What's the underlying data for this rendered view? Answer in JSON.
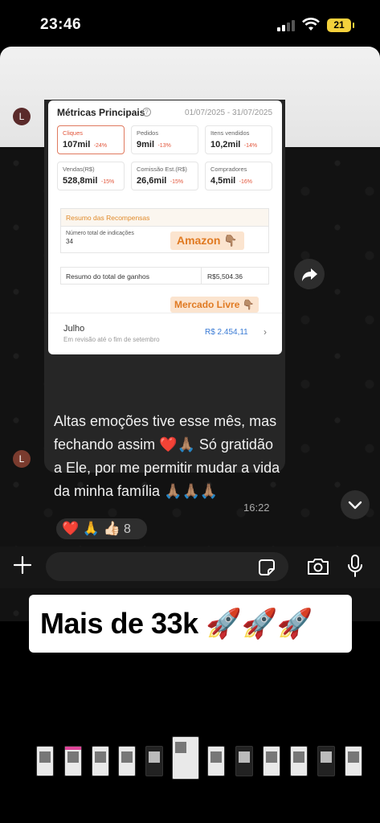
{
  "status_bar": {
    "time": "23:46",
    "battery": "21",
    "colors": {
      "battery": "#f4d13c"
    }
  },
  "chat": {
    "avatar_letter": "L",
    "screenshot": {
      "title": "Métricas Principais",
      "date_range": "01/07/2025 - 31/07/2025",
      "metrics": [
        {
          "label": "Cliques",
          "value": "107mil",
          "delta": "-24%"
        },
        {
          "label": "Pedidos",
          "value": "9mil",
          "delta": "-13%"
        },
        {
          "label": "Itens vendidos",
          "value": "10,2mil",
          "delta": "-14%"
        },
        {
          "label": "Vendas(R$)",
          "value": "528,8mil",
          "delta": "-15%"
        },
        {
          "label": "Comissão Est.(R$)",
          "value": "26,6mil",
          "delta": "-15%"
        },
        {
          "label": "Compradores",
          "value": "4,5mil",
          "delta": "-16%"
        }
      ],
      "rewards_header": "Resumo das Recompensas",
      "referrals_label": "Número total de indicações",
      "referrals_value": "34",
      "amazon_tag": "Amazon 👇🏽",
      "earnings_label": "Resumo do total de ganhos",
      "earnings_value": "R$5,504.36",
      "mercado_livre_tag": "Mercado Livre 👇🏽",
      "month": "Julho",
      "month_status": "Em revisão até o fim de setembro",
      "month_value": "R$ 2.454,11"
    },
    "message_text": "Altas emoções tive esse mês, mas fechando assim ❤️🙏🏽 Só gratidão a Ele, por me permitir mudar a vida da minha família 🙏🏽🙏🏽🙏🏽",
    "time": "16:22",
    "reactions": "❤️ 🙏 👍🏻",
    "reaction_count": "8"
  },
  "input_bar": {
    "icons": [
      "plus-icon",
      "sticker-icon",
      "camera-icon",
      "microphone-icon"
    ]
  },
  "caption": "Mais de 33k 🚀🚀🚀",
  "colors": {
    "accent_orange": "#e07a22",
    "negative_red": "#e2553a",
    "link_blue": "#3a7bd5"
  }
}
